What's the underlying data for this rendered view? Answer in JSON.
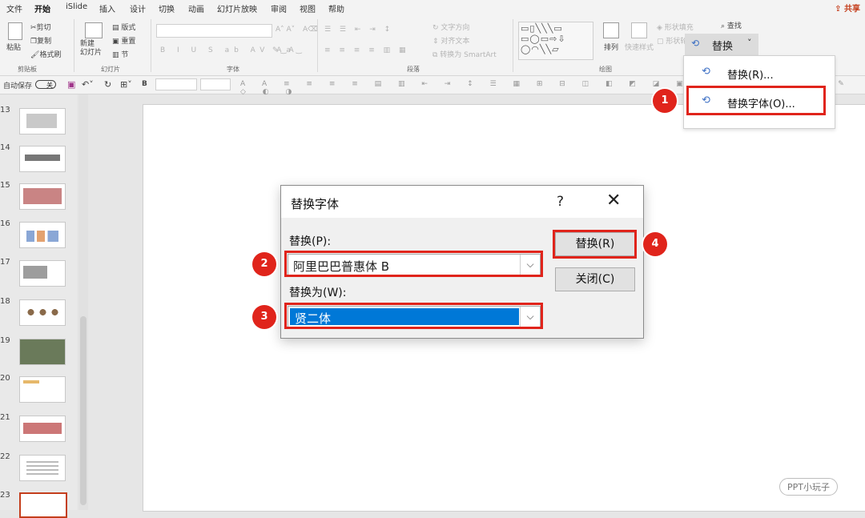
{
  "menu": {
    "tabs": [
      "文件",
      "开始",
      "iSlide",
      "插入",
      "设计",
      "切换",
      "动画",
      "幻灯片放映",
      "审阅",
      "视图",
      "帮助"
    ],
    "share": "共享"
  },
  "ribbon": {
    "clipboard": {
      "paste": "粘贴",
      "cut": "剪切",
      "copy": "复制",
      "format_painter": "格式刷",
      "group": "剪贴板"
    },
    "slides": {
      "new_slide": "新建\n幻灯片",
      "layout": "版式",
      "reset": "重置",
      "section": "节",
      "group": "幻灯片"
    },
    "font": {
      "group": "字体"
    },
    "paragraph": {
      "text_direction": "文字方向",
      "align_text": "对齐文本",
      "smartart": "转换为 SmartArt",
      "group": "段落"
    },
    "drawing": {
      "arrange": "排列",
      "quick_styles": "快速样式",
      "shape_fill": "形状填充",
      "shape_outline": "形状轮廓",
      "group": "绘图"
    },
    "editing": {
      "find": "查找",
      "replace": "替换"
    }
  },
  "qat": {
    "autosave": "自动保存",
    "autosave_state": "关",
    "bold": "B"
  },
  "slides_panel": {
    "numbers": [
      "13",
      "14",
      "15",
      "16",
      "17",
      "18",
      "19",
      "20",
      "21",
      "22",
      "23"
    ],
    "selected": "23"
  },
  "replace_menu": {
    "button": "替换",
    "items": [
      {
        "label": "替换(R)...",
        "key": "R"
      },
      {
        "label": "替换字体(O)...",
        "key": "O"
      }
    ]
  },
  "dialog": {
    "title": "替换字体",
    "help": "?",
    "close": "✕",
    "replace_label": "替换(P):",
    "replace_value": "阿里巴巴普惠体 B",
    "with_label": "替换为(W):",
    "with_value": "贤二体",
    "replace_button": "替换(R)",
    "close_button": "关闭(C)"
  },
  "steps": [
    "1",
    "2",
    "3",
    "4"
  ],
  "watermark": "PPT小玩子",
  "colors": {
    "accent": "#c43e1c",
    "highlight": "#e0241b",
    "selection": "#0078d7"
  }
}
